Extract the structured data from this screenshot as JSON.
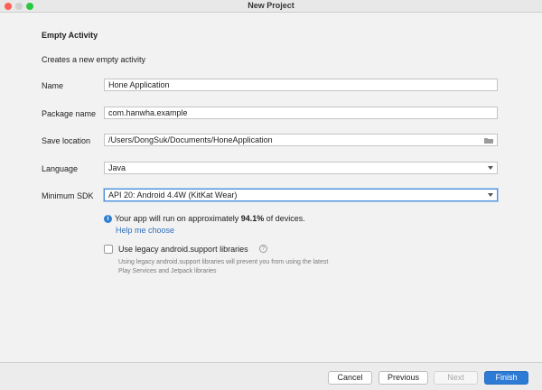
{
  "window": {
    "title": "New Project"
  },
  "form": {
    "heading": "Empty Activity",
    "description": "Creates a new empty activity",
    "name": {
      "label": "Name",
      "value": "Hone Application"
    },
    "package": {
      "label": "Package name",
      "value": "com.hanwha.example"
    },
    "save_location": {
      "label": "Save location",
      "value": "/Users/DongSuk/Documents/HoneApplication"
    },
    "language": {
      "label": "Language",
      "value": "Java"
    },
    "min_sdk": {
      "label": "Minimum SDK",
      "value": "API 20: Android 4.4W (KitKat Wear)"
    },
    "info": {
      "prefix": "Your app will run on approximately ",
      "percent": "94.1%",
      "suffix": " of devices."
    },
    "help_link": "Help me choose",
    "legacy": {
      "label": "Use legacy android.support libraries",
      "checked": false,
      "hint": "Using legacy android.support libraries will prevent you from using the latest Play Services and Jetpack libraries"
    }
  },
  "footer": {
    "cancel": "Cancel",
    "previous": "Previous",
    "next": "Next",
    "finish": "Finish"
  },
  "colors": {
    "accent": "#2e7bd6",
    "link": "#2f6fbd",
    "info": "#2f7fd0"
  }
}
